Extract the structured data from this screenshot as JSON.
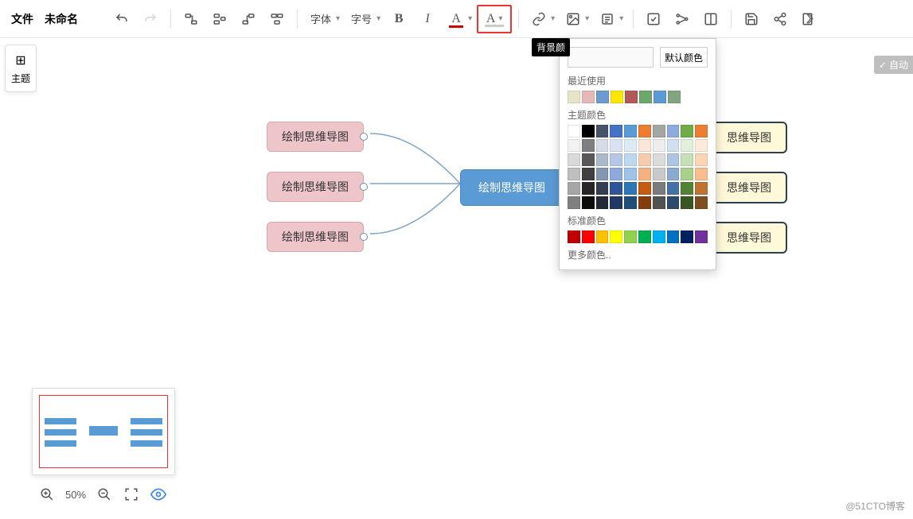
{
  "toolbar": {
    "file": "文件",
    "docName": "未命名",
    "font": "字体",
    "fontSize": "字号"
  },
  "tooltip": "背景颜",
  "sideTheme": "主题",
  "autoBtn": "自动",
  "popup": {
    "defaultColor": "默认颜色",
    "recent": "最近使用",
    "recentColors": [
      "#e8e4c9",
      "#e6b8b8",
      "#6b9bd1",
      "#ffe600",
      "#b35959",
      "#6ca86c",
      "#5b9bd5",
      "#7fa67f"
    ],
    "themeLabel": "主题颜色",
    "themeColors": [
      [
        "#ffffff",
        "#000000",
        "#44546a",
        "#4472c4",
        "#5b9bd5",
        "#ed7d31",
        "#a5a5a5",
        "#8faadc",
        "#70ad47",
        "#ed7d31"
      ],
      [
        "#f2f2f2",
        "#7f7f7f",
        "#d6dce5",
        "#d9e2f3",
        "#deebf7",
        "#fbe5d6",
        "#ededed",
        "#d0e0f0",
        "#e2f0d9",
        "#fdeada"
      ],
      [
        "#d9d9d9",
        "#595959",
        "#acb9ca",
        "#b4c7e7",
        "#bdd7ee",
        "#f8cbad",
        "#dbdbdb",
        "#adc5e0",
        "#c5e0b4",
        "#fbd5b5"
      ],
      [
        "#bfbfbf",
        "#404040",
        "#8497b0",
        "#8eaadc",
        "#9dc3e6",
        "#f4b183",
        "#c9c9c9",
        "#8aabd0",
        "#a9d18e",
        "#f9bd8e"
      ],
      [
        "#a6a6a6",
        "#262626",
        "#333f50",
        "#2e5597",
        "#2e75b6",
        "#c55a11",
        "#7b7b7b",
        "#4472a8",
        "#548235",
        "#bf7330"
      ],
      [
        "#808080",
        "#0d0d0d",
        "#222a35",
        "#1f3864",
        "#1f4e79",
        "#843c0c",
        "#525252",
        "#2c4a6e",
        "#385723",
        "#7f4e20"
      ]
    ],
    "standardLabel": "标准颜色",
    "standardColors": [
      "#c00000",
      "#ff0000",
      "#ffc000",
      "#ffff00",
      "#92d050",
      "#00b050",
      "#00b0f0",
      "#0070c0",
      "#002060",
      "#7030a0"
    ],
    "more": "更多颜色.."
  },
  "nodes": {
    "center": "绘制思维导图",
    "left": [
      "绘制思维导图",
      "绘制思维导图",
      "绘制思维导图"
    ],
    "right": [
      "思维导图",
      "思维导图",
      "思维导图"
    ]
  },
  "zoom": "50%",
  "watermark": "@51CTO博客"
}
